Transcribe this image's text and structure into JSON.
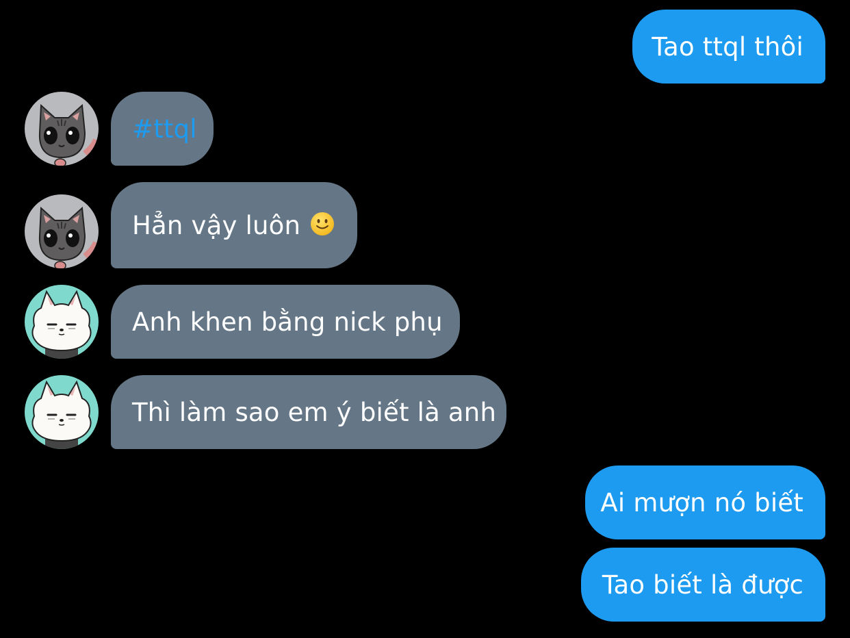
{
  "messages": [
    {
      "direction": "outgoing",
      "text": "Tao ttql thôi"
    },
    {
      "direction": "incoming",
      "sender": "gray-cat",
      "text": "#ttql",
      "is_hashtag": true
    },
    {
      "direction": "incoming",
      "sender": "gray-cat",
      "text": "Hẳn vậy luôn",
      "emoji": "slightly-smiling-face"
    },
    {
      "direction": "incoming",
      "sender": "white-dog",
      "text": "Anh khen bằng nick phụ"
    },
    {
      "direction": "incoming",
      "sender": "white-dog",
      "text": "Thì làm sao em ý biết là anh"
    },
    {
      "direction": "outgoing",
      "text": "Ai mượn nó biết"
    },
    {
      "direction": "outgoing",
      "text": "Tao biết là được"
    }
  ],
  "avatars": {
    "gray-cat": {
      "icon": "gray-cat-avatar-icon",
      "background": "#b9babd"
    },
    "white-dog": {
      "icon": "white-dog-avatar-icon",
      "background": "#7fd9cc"
    }
  },
  "colors": {
    "background": "#000000",
    "outgoing_bubble": "#1d9bf0",
    "incoming_bubble": "#657786",
    "hashtag": "#1d9bf0",
    "text": "#ffffff"
  }
}
